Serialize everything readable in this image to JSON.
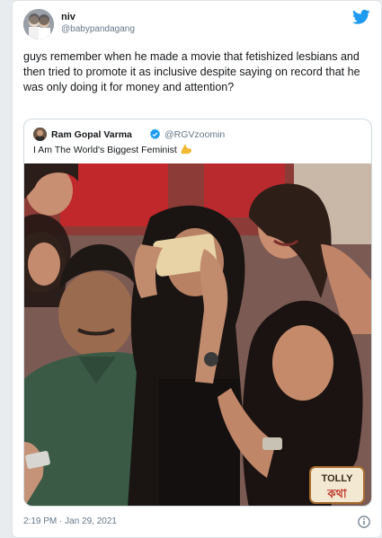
{
  "author": {
    "display_name": "niv",
    "handle": "@babypandagang",
    "avatar_icon": "profile-photo-avatar"
  },
  "brand_icon": "twitter-bird-icon",
  "brand_color": "#1d9bf0",
  "tweet_text": "guys remember when he made a movie that fetishized lesbians and then tried to promote it as inclusive despite saying on record that he was only doing it for money and attention?",
  "quoted": {
    "display_name": "Ram Gopal Varma",
    "verified_icon": "verified-badge-icon",
    "handle": "@RGVzoomin",
    "text": "I Am The World's Biggest Feminist",
    "emoji_icon": "flexed-biceps-icon",
    "photo_description_icon": "group-selfie-photo",
    "watermark_text": "TOLLY কথা"
  },
  "timestamp": "2:19 PM · Jan 29, 2021",
  "info_icon": "info-icon"
}
